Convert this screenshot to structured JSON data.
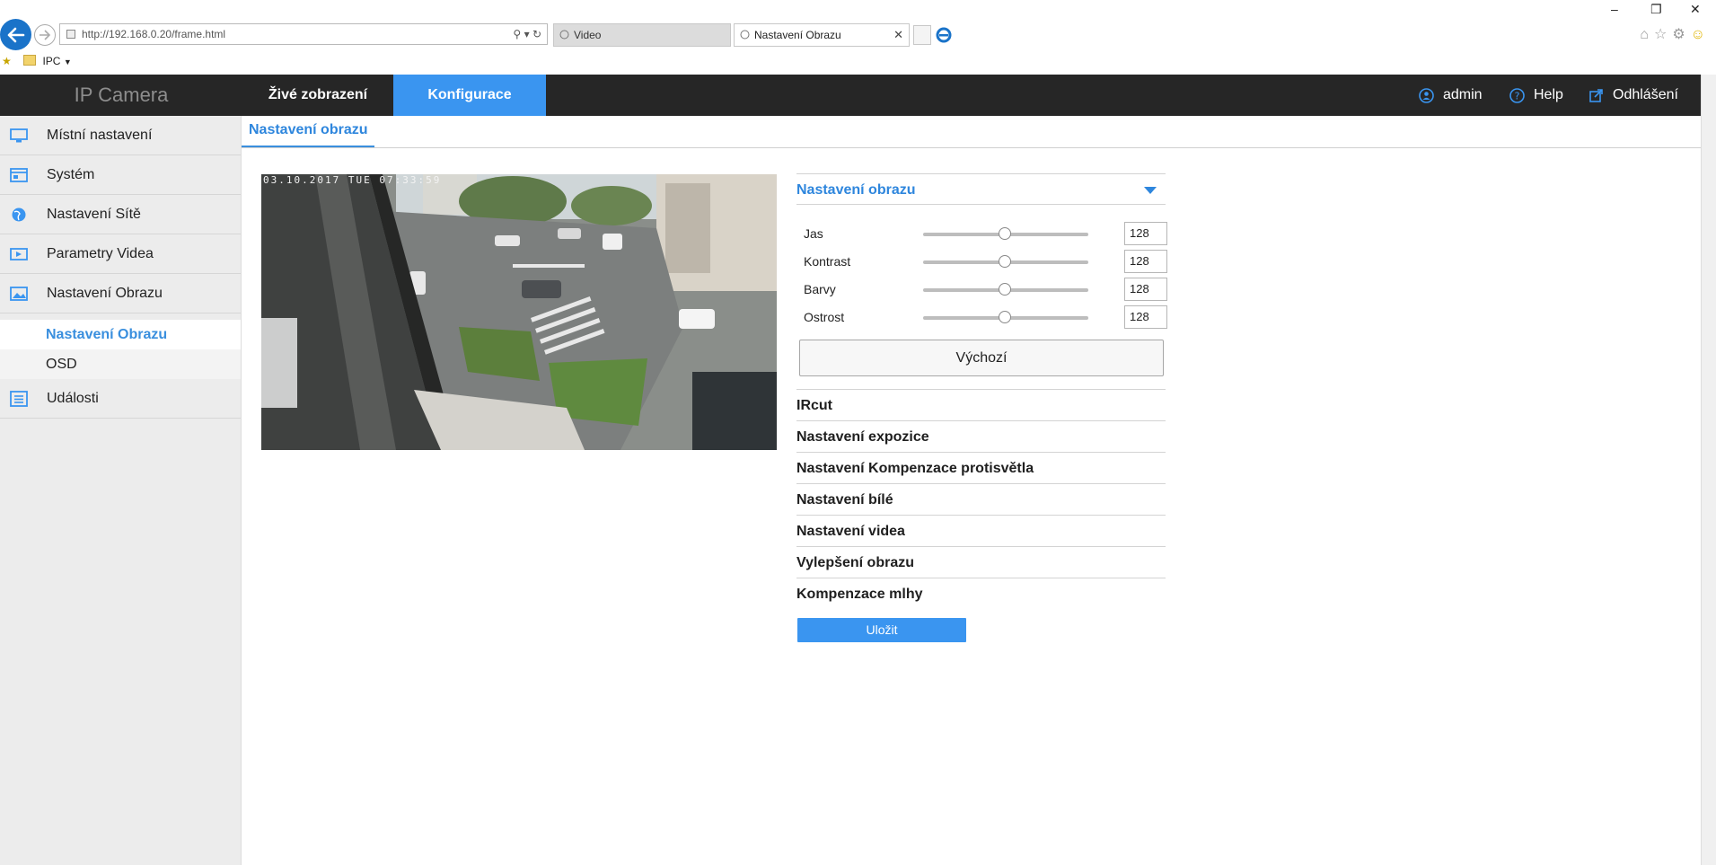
{
  "browser": {
    "url": "http://192.168.0.20/frame.html",
    "tabs": [
      {
        "label": "Video"
      },
      {
        "label": "Nastavení Obrazu"
      }
    ],
    "favorites": [
      {
        "label": "IPC"
      }
    ],
    "window_controls": {
      "minimize": "–",
      "restore": "❐",
      "close": "✕"
    }
  },
  "header": {
    "brand": "IP Camera",
    "nav": [
      {
        "label": "Živé zobrazení",
        "active": false
      },
      {
        "label": "Konfigurace",
        "active": true
      }
    ],
    "user": "admin",
    "help": "Help",
    "logout": "Odhlášení"
  },
  "sidebar": {
    "items": [
      {
        "label": "Místní nastavení",
        "icon": "monitor-icon"
      },
      {
        "label": "Systém",
        "icon": "system-window-icon"
      },
      {
        "label": "Nastavení Sítě",
        "icon": "globe-icon"
      },
      {
        "label": "Parametry Videa",
        "icon": "video-icon"
      },
      {
        "label": "Nastavení Obrazu",
        "icon": "image-icon"
      },
      {
        "label": "Události",
        "icon": "events-list-icon"
      }
    ],
    "subitems": [
      {
        "label": "Nastavení Obrazu",
        "active": true
      },
      {
        "label": "OSD",
        "active": false
      }
    ]
  },
  "content": {
    "tab_title": "Nastavení obrazu",
    "video_osd": "03.10.2017 TUE 07:33:59"
  },
  "panel": {
    "open_section": "Nastavení obrazu",
    "sliders": [
      {
        "label": "Jas",
        "value": "128",
        "fraction": 0.5
      },
      {
        "label": "Kontrast",
        "value": "128",
        "fraction": 0.5
      },
      {
        "label": "Barvy",
        "value": "128",
        "fraction": 0.5
      },
      {
        "label": "Ostrost",
        "value": "128",
        "fraction": 0.5
      }
    ],
    "default_button": "Výchozí",
    "sections": [
      "IRcut",
      "Nastavení expozice",
      "Nastavení Kompenzace protisvětla",
      "Nastavení bílé",
      "Nastavení videa",
      "Vylepšení obrazu",
      "Kompenzace mlhy"
    ],
    "save_button": "Uložit"
  },
  "colors": {
    "accent": "#3a95f0",
    "header_bg": "#262626",
    "sidebar_bg": "#ececec",
    "link_blue": "#2e86dd"
  }
}
